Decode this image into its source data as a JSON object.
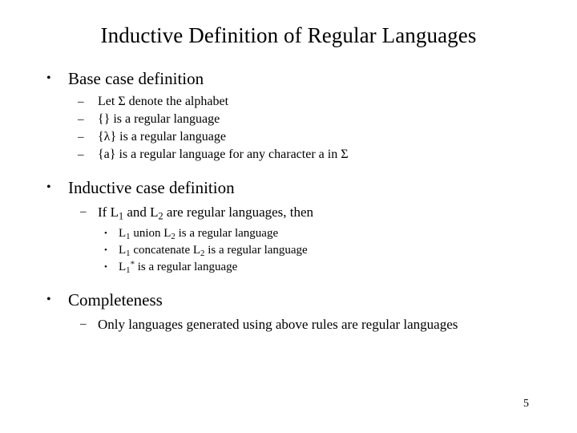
{
  "slide": {
    "title": "Inductive Definition of Regular Languages",
    "page_number": "5",
    "background_color": "#ffffff",
    "text_color": "#000000",
    "markers": {
      "level1": "•",
      "level2": "–",
      "level3": "•"
    },
    "sections": [
      {
        "heading": "Base case definition",
        "items": [
          {
            "text": "Let Σ denote the alphabet"
          },
          {
            "text": "{} is a regular language"
          },
          {
            "text": "{λ} is a regular language"
          },
          {
            "text": "{a} is a regular language for any character a in Σ"
          }
        ]
      },
      {
        "heading": "Inductive case definition",
        "lead": {
          "pre": "If L",
          "sub1": "1",
          "mid": " and L",
          "sub2": "2",
          "post": " are regular languages, then"
        },
        "subitems": [
          {
            "pre": "L",
            "sub1": "1",
            "mid": " union L",
            "sub2": "2",
            "post": " is a regular language"
          },
          {
            "pre": "L",
            "sub1": "1",
            "mid": " concatenate L",
            "sub2": "2",
            "post": " is a regular language"
          },
          {
            "pre": "L",
            "sub1": "1",
            "star": "*",
            "post": " is a regular language"
          }
        ]
      },
      {
        "heading": "Completeness",
        "items": [
          {
            "text": "Only languages generated using above rules are regular languages"
          }
        ]
      }
    ]
  }
}
